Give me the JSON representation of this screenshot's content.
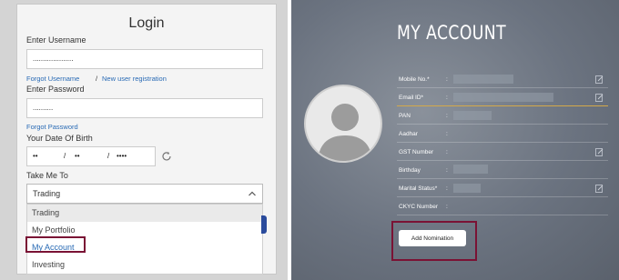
{
  "login": {
    "title": "Login",
    "username_label": "Enter Username",
    "username_value": "....................",
    "forgot_username": "Forgot Username",
    "separator": "/",
    "new_user": "New user registration",
    "password_label": "Enter Password",
    "password_value": "..........",
    "forgot_password": "Forgot Password",
    "dob_label": "Your Date Of Birth",
    "dob": {
      "dd": "••",
      "mm": "••",
      "yyyy": "••••",
      "slash": "/"
    },
    "take_me_label": "Take Me To",
    "selected": "Trading",
    "options": [
      "Trading",
      "My Portfolio",
      "My Account",
      "Investing"
    ]
  },
  "account": {
    "title": "MY ACCOUNT",
    "colon": ":",
    "rows": [
      {
        "label": "Mobile No.*"
      },
      {
        "label": "Email ID*"
      },
      {
        "label": "PAN"
      },
      {
        "label": "Aadhar"
      },
      {
        "label": "GST Number"
      },
      {
        "label": "Birthday"
      },
      {
        "label": "Marital Status*"
      },
      {
        "label": "CKYC Number"
      }
    ],
    "add_nomination": "Add Nomination"
  },
  "colors": {
    "link": "#2a6bb5",
    "highlight": "#7a1234",
    "active_underline": "#d4a94a",
    "panel_bg": "#6b7380"
  },
  "icons": [
    "refresh-icon",
    "chevron-up-icon",
    "user-avatar-icon",
    "edit-icon"
  ]
}
